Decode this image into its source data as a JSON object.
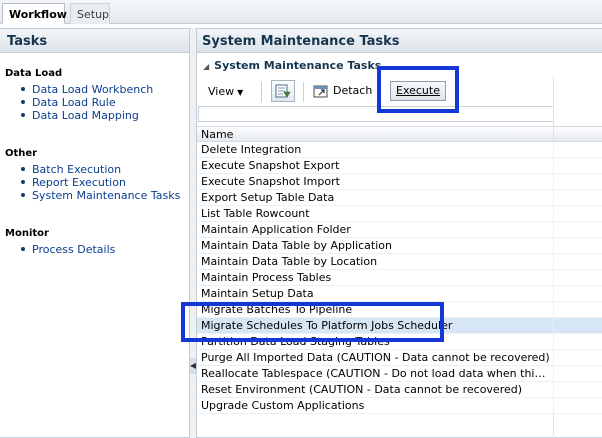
{
  "tabs": {
    "workflow": "Workflow",
    "setup": "Setup"
  },
  "left_panel": {
    "title": "Tasks",
    "groups": [
      {
        "title": "Data Load",
        "items": [
          "Data Load Workbench",
          "Data Load Rule",
          "Data Load Mapping"
        ]
      },
      {
        "title": "Other",
        "items": [
          "Batch Execution",
          "Report Execution",
          "System Maintenance Tasks"
        ]
      },
      {
        "title": "Monitor",
        "items": [
          "Process Details"
        ]
      }
    ]
  },
  "right_panel": {
    "title": "System Maintenance Tasks",
    "subtitle": "System Maintenance Tasks",
    "toolbar": {
      "view": "View",
      "detach": "Detach",
      "execute": "Execute"
    },
    "table": {
      "column": "Name",
      "rows": [
        "Delete Integration",
        "Execute Snapshot Export",
        "Execute Snapshot Import",
        "Export Setup Table Data",
        "List Table Rowcount",
        "Maintain Application Folder",
        "Maintain Data Table by Application",
        "Maintain Data Table by Location",
        "Maintain Process Tables",
        "Maintain Setup Data",
        "Migrate Batches To Pipeline",
        "Migrate Schedules To Platform Jobs Scheduler",
        "Partition Data Load Staging Tables",
        "Purge All Imported Data (CAUTION - Data cannot be recovered)",
        "Reallocate Tablespace (CAUTION - Do not load data when this process is running)",
        "Reset Environment (CAUTION - Data cannot be recovered)",
        "Upgrade Custom Applications"
      ],
      "selected_row": "Migrate Schedules To Platform Jobs Scheduler"
    }
  },
  "colors": {
    "highlight": "#1438d6",
    "selected_row": "#d7e6f5",
    "link": "#0b3d91",
    "header_text": "#16364f"
  }
}
